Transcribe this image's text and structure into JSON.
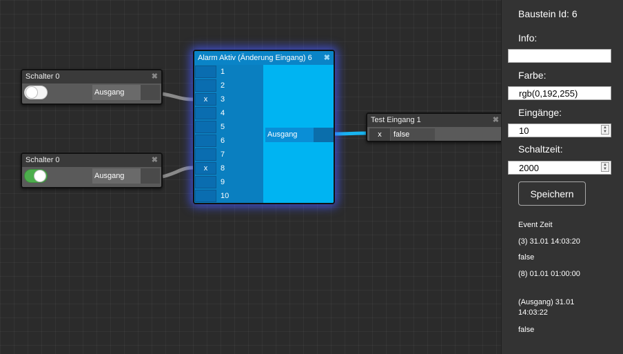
{
  "nodes": {
    "switch1": {
      "title": "Schalter 0",
      "output_label": "Ausgang",
      "state": "off"
    },
    "switch2": {
      "title": "Schalter 0",
      "output_label": "Ausgang",
      "state": "on"
    },
    "alarm": {
      "title": "Alarm Aktiv (Änderung Eingang) 6",
      "output_label": "Ausgang",
      "inputs": [
        {
          "label": "1",
          "mark": ""
        },
        {
          "label": "2",
          "mark": ""
        },
        {
          "label": "3",
          "mark": "x"
        },
        {
          "label": "4",
          "mark": ""
        },
        {
          "label": "5",
          "mark": ""
        },
        {
          "label": "6",
          "mark": ""
        },
        {
          "label": "7",
          "mark": ""
        },
        {
          "label": "8",
          "mark": "x"
        },
        {
          "label": "9",
          "mark": ""
        },
        {
          "label": "10",
          "mark": ""
        }
      ],
      "color": "#00c0ff"
    },
    "test": {
      "title": "Test Eingang 1",
      "input_mark": "x",
      "value": "false"
    }
  },
  "sidebar": {
    "block_id": "Baustein Id: 6",
    "info_label": "Info:",
    "info_value": "",
    "color_label": "Farbe:",
    "color_value": "rgb(0,192,255)",
    "inputs_label": "Eingänge:",
    "inputs_value": "10",
    "switch_time_label": "Schaltzeit:",
    "switch_time_value": "2000",
    "save_label": "Speichern",
    "event_header": "Event Zeit",
    "events": [
      "(3) 31.01 14:03:20",
      "false",
      "(8) 01.01 01:00:00",
      "(Ausgang) 31.01 14:03:22",
      "false"
    ]
  }
}
